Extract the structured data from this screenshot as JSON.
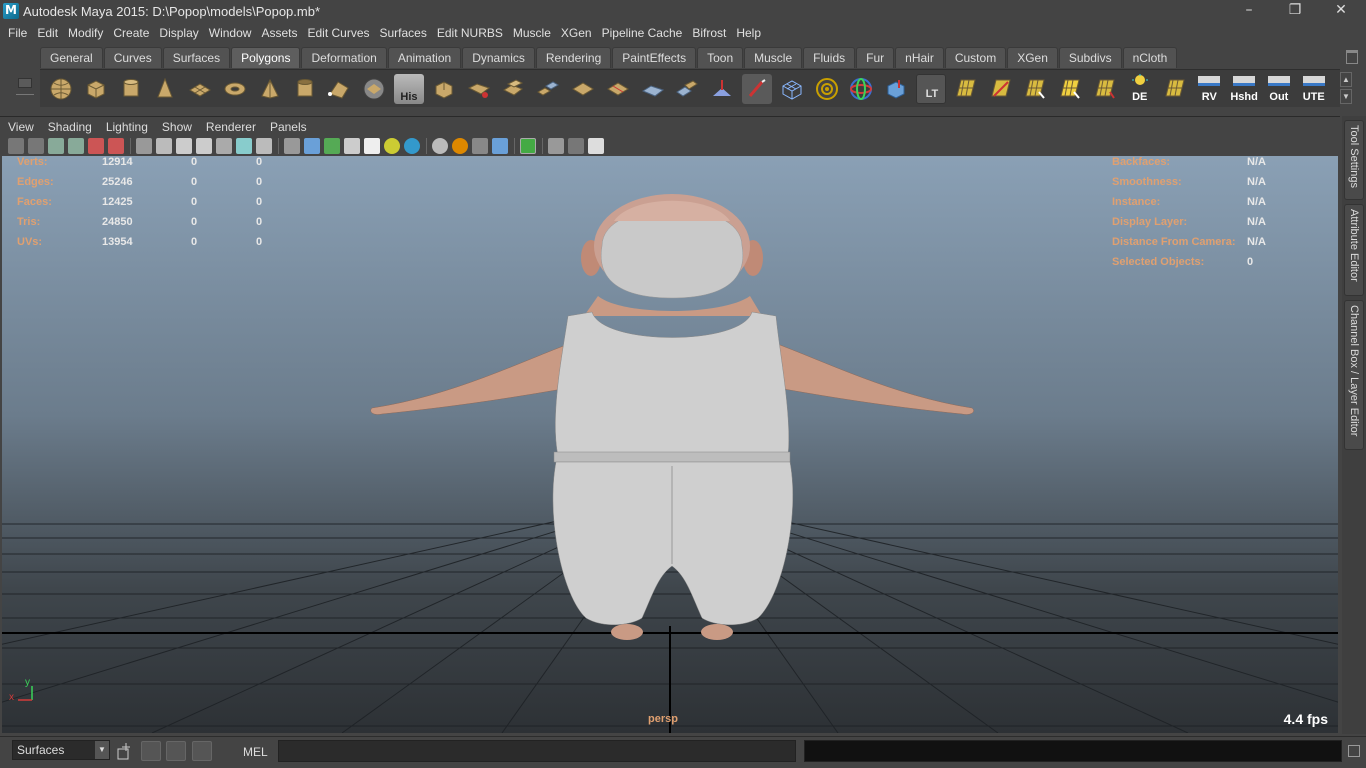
{
  "window": {
    "title": "Autodesk Maya 2015: D:\\Popop\\models\\Popop.mb*",
    "controls": [
      "–",
      "❐",
      "✕"
    ]
  },
  "menubar": [
    "File",
    "Edit",
    "Modify",
    "Create",
    "Display",
    "Window",
    "Assets",
    "Edit Curves",
    "Surfaces",
    "Edit NURBS",
    "Muscle",
    "XGen",
    "Pipeline Cache",
    "Bifrost",
    "Help"
  ],
  "shelf": {
    "tabs": [
      "General",
      "Curves",
      "Surfaces",
      "Polygons",
      "Deformation",
      "Animation",
      "Dynamics",
      "Rendering",
      "PaintEffects",
      "Toon",
      "Muscle",
      "Fluids",
      "Fur",
      "nHair",
      "Custom",
      "XGen",
      "Subdivs",
      "nCloth"
    ],
    "active_tab": "Polygons",
    "text_buttons": {
      "his": "His",
      "lt": "LT",
      "de": "DE",
      "rv": "RV",
      "hshd": "Hshd",
      "out": "Out",
      "ute": "UTE"
    }
  },
  "panel": {
    "menus": [
      "View",
      "Shading",
      "Lighting",
      "Show",
      "Renderer",
      "Panels"
    ]
  },
  "hud": {
    "left": [
      {
        "label": "Verts:",
        "v1": "12914",
        "v2": "0",
        "v3": "0"
      },
      {
        "label": "Edges:",
        "v1": "25246",
        "v2": "0",
        "v3": "0"
      },
      {
        "label": "Faces:",
        "v1": "12425",
        "v2": "0",
        "v3": "0"
      },
      {
        "label": "Tris:",
        "v1": "24850",
        "v2": "0",
        "v3": "0"
      },
      {
        "label": "UVs:",
        "v1": "13954",
        "v2": "0",
        "v3": "0"
      }
    ],
    "right": [
      {
        "label": "Backfaces:",
        "value": "N/A"
      },
      {
        "label": "Smoothness:",
        "value": "N/A"
      },
      {
        "label": "Instance:",
        "value": "N/A"
      },
      {
        "label": "Display Layer:",
        "value": "N/A"
      },
      {
        "label": "Distance From Camera:",
        "value": "N/A"
      },
      {
        "label": "Selected Objects:",
        "value": "0"
      }
    ],
    "camera": "persp",
    "fps": "4.4 fps",
    "axis_x": "x",
    "axis_y": "y"
  },
  "sidetabs": [
    "Tool Settings",
    "Attribute Editor",
    "Channel Box / Layer Editor"
  ],
  "commandline": {
    "menuset": "Surfaces",
    "language": "MEL",
    "input_value": "",
    "result_value": ""
  }
}
